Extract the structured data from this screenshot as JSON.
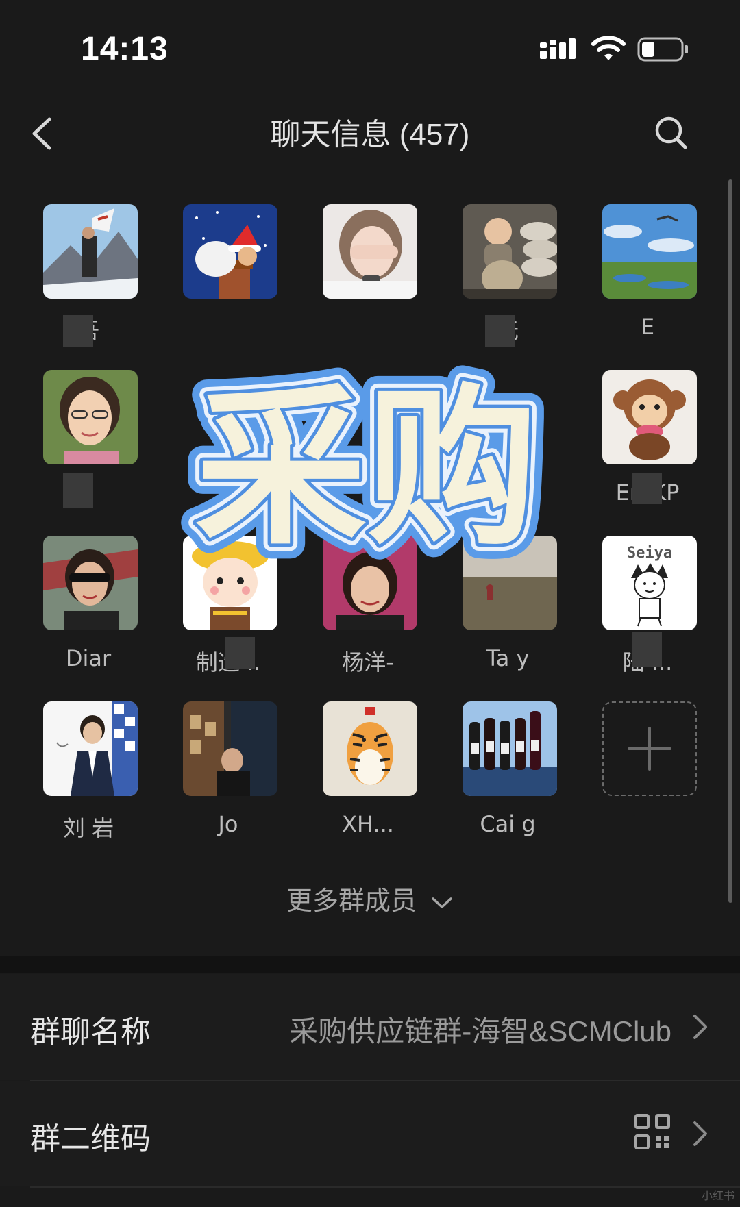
{
  "status_bar": {
    "time": "14:13"
  },
  "nav": {
    "title": "聊天信息 (457)"
  },
  "members": [
    {
      "name": "吾"
    },
    {
      "name": ""
    },
    {
      "name": ""
    },
    {
      "name": "无"
    },
    {
      "name": "E"
    },
    {
      "name": ""
    },
    {
      "name": ""
    },
    {
      "name": ""
    },
    {
      "name": ""
    },
    {
      "name": "Eri   KP"
    },
    {
      "name": "Diar   "
    },
    {
      "name": "制造   .."
    },
    {
      "name": "杨洋-"
    },
    {
      "name": "Ta   y"
    },
    {
      "name": "陆   ..."
    },
    {
      "name": "刘   岩"
    },
    {
      "name": "Jo"
    },
    {
      "name": "XH..."
    },
    {
      "name": "Cai   g"
    }
  ],
  "sticker_text": "采购",
  "more_members": {
    "label": "更多群成员"
  },
  "settings": {
    "group_name": {
      "label": "群聊名称",
      "value": "采购供应链群-海智&SCMClub"
    },
    "qr_code": {
      "label": "群二维码"
    }
  },
  "icons": {
    "back": "chevron-left-icon",
    "search": "search-icon",
    "more": "chevron-down-icon",
    "add": "plus-icon",
    "qr": "qr-code-icon",
    "row": "chevron-right-icon"
  },
  "colors": {
    "background": "#1a1a1a",
    "sticker_fill": "#f6f2dc",
    "sticker_outline": "#4f8fe0"
  },
  "watermark": "小红书"
}
